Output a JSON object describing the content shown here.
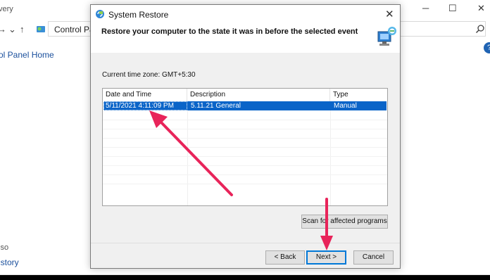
{
  "background_window": {
    "title_fragment": "very",
    "address_text": "Control Panel",
    "left_link": "ol Panel Home",
    "also_label": "lso",
    "history_link": "istory",
    "help_label": "?",
    "controls": {
      "minimize": "─",
      "maximize": "☐",
      "close": "✕"
    },
    "nav": {
      "back": "←",
      "up": "↑",
      "forward": "→",
      "dropdown": "⌄"
    }
  },
  "dialog": {
    "title": "System Restore",
    "close_label": "✕",
    "heading": "Restore your computer to the state it was in before the selected event",
    "timezone": "Current time zone: GMT+5:30",
    "table": {
      "headers": [
        "Date and Time",
        "Description",
        "Type"
      ],
      "rows": [
        {
          "date": "5/11/2021 4:11:09 PM",
          "description": "5.11.21 General",
          "type": "Manual"
        }
      ]
    },
    "scan_button": "Scan for affected programs",
    "back_button": "< Back",
    "next_button": "Next >",
    "cancel_button": "Cancel"
  },
  "annotation_color": "#e8245a"
}
